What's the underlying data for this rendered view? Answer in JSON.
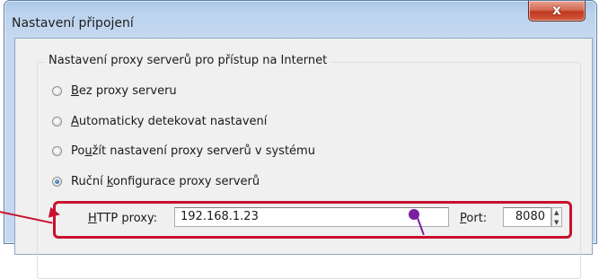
{
  "window": {
    "title": "Nastavení připojení",
    "close_glyph": "x"
  },
  "group": {
    "legend": "Nastavení proxy serverů pro přístup na Internet"
  },
  "options": [
    {
      "pre": "",
      "acc": "B",
      "post": "ez proxy serveru",
      "checked": false
    },
    {
      "pre": "",
      "acc": "A",
      "post": "utomaticky detekovat nastavení",
      "checked": false
    },
    {
      "pre": "Po",
      "acc": "u",
      "post": "žít nastavení proxy serverů v systému",
      "checked": false
    },
    {
      "pre": "Ruční ",
      "acc": "k",
      "post": "onfigurace proxy serverů",
      "checked": true
    }
  ],
  "http": {
    "label_acc": "H",
    "label_rest": "TTP proxy:",
    "value": "192.168.1.23",
    "port_acc": "P",
    "port_rest": "ort:",
    "port_value": "8080"
  },
  "colors": {
    "highlight": "#c8102e",
    "annotation_arrow": "#c8102e",
    "cursor": "#7b1fa2"
  }
}
